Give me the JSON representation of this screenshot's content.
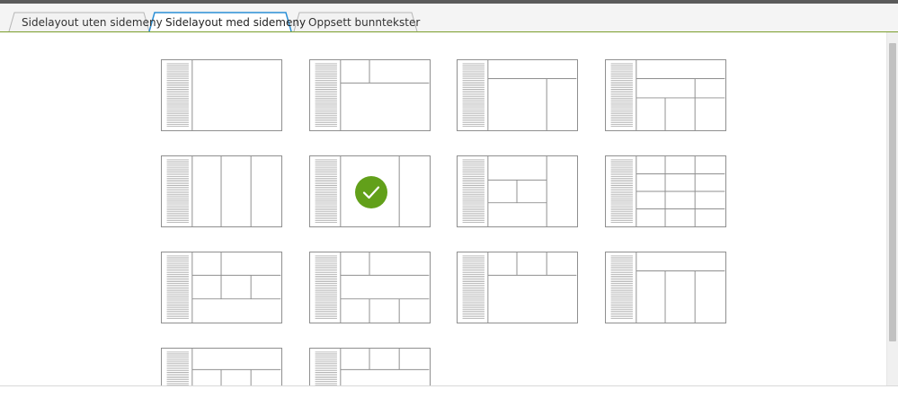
{
  "tabs": [
    {
      "label": "Sidelayout uten sidemeny",
      "active": false
    },
    {
      "label": "Sidelayout med sidemeny",
      "active": true
    },
    {
      "label": "Oppsett bunntekster",
      "active": false
    }
  ],
  "layouts": {
    "selected_index": 5,
    "count": 14
  },
  "colors": {
    "accent_green": "#62a01a",
    "active_tab_border": "#2a8fd6",
    "tabbar_underline": "#7a9e2b"
  },
  "icons": {
    "selected": "check-circle-icon"
  }
}
